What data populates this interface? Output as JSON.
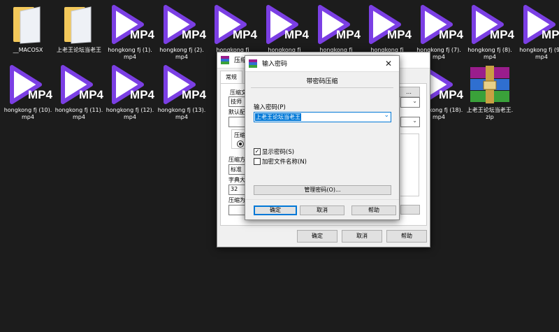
{
  "desktop": {
    "icons": [
      {
        "label": "__MACOSX",
        "type": "folder"
      },
      {
        "label": "上老王论坛当老王",
        "type": "folder"
      },
      {
        "label": "hongkong fj (1).mp4",
        "type": "mp4"
      },
      {
        "label": "hongkong fj (2).mp4",
        "type": "mp4"
      },
      {
        "label": "hongkong fj",
        "type": "mp4"
      },
      {
        "label": "hongkong fj",
        "type": "mp4"
      },
      {
        "label": "hongkong fj",
        "type": "mp4"
      },
      {
        "label": "hongkong fj",
        "type": "mp4"
      },
      {
        "label": "hongkong fj (7).mp4",
        "type": "mp4"
      },
      {
        "label": "hongkong fj (8).mp4",
        "type": "mp4"
      },
      {
        "label": "hongkong fj (9).mp4",
        "type": "mp4"
      },
      {
        "label": "hongkong fj (10).mp4",
        "type": "mp4"
      },
      {
        "label": "hongkong fj (11).mp4",
        "type": "mp4"
      },
      {
        "label": "hongkong fj (12).mp4",
        "type": "mp4"
      },
      {
        "label": "hongkong fj (13).mp4",
        "type": "mp4"
      },
      {
        "label": "hongkong fj (18).mp4",
        "type": "mp4"
      },
      {
        "label": "上老王论坛当老王.zip",
        "type": "rar"
      }
    ],
    "mp4_badge": "MP4",
    "icon_names": {
      "folder": "folder-icon",
      "mp4": "video-file-icon",
      "rar": "winrar-archive-icon"
    },
    "colors": {
      "play": "#7b3fe4",
      "folder": "#f3c85a",
      "background": "#1c1c1c"
    }
  },
  "back_window": {
    "title": "压缩文",
    "tab": "常规",
    "fragments": {
      "archive_name": "压缩文",
      "name_value": "技师",
      "default": "默认配",
      "compress": "压缩",
      "method": "压缩方",
      "method_value": "标准",
      "dict": "字典大",
      "dict_value": "32",
      "volume": "压缩为"
    },
    "buttons": {
      "ok": "确定",
      "cancel": "取消",
      "help": "帮助"
    }
  },
  "dialog": {
    "title": "输入密码",
    "heading": "带密码压缩",
    "password_label": "输入密码(P)",
    "password_value": "上老王论坛当老王",
    "show_password": "显示密码(S)",
    "show_password_checked": true,
    "encrypt_names": "加密文件名称(N)",
    "encrypt_names_checked": false,
    "manage_button": "管理密码(O)...",
    "buttons": {
      "ok": "确定",
      "cancel": "取消",
      "help": "帮助"
    },
    "close_glyph": "✕"
  }
}
